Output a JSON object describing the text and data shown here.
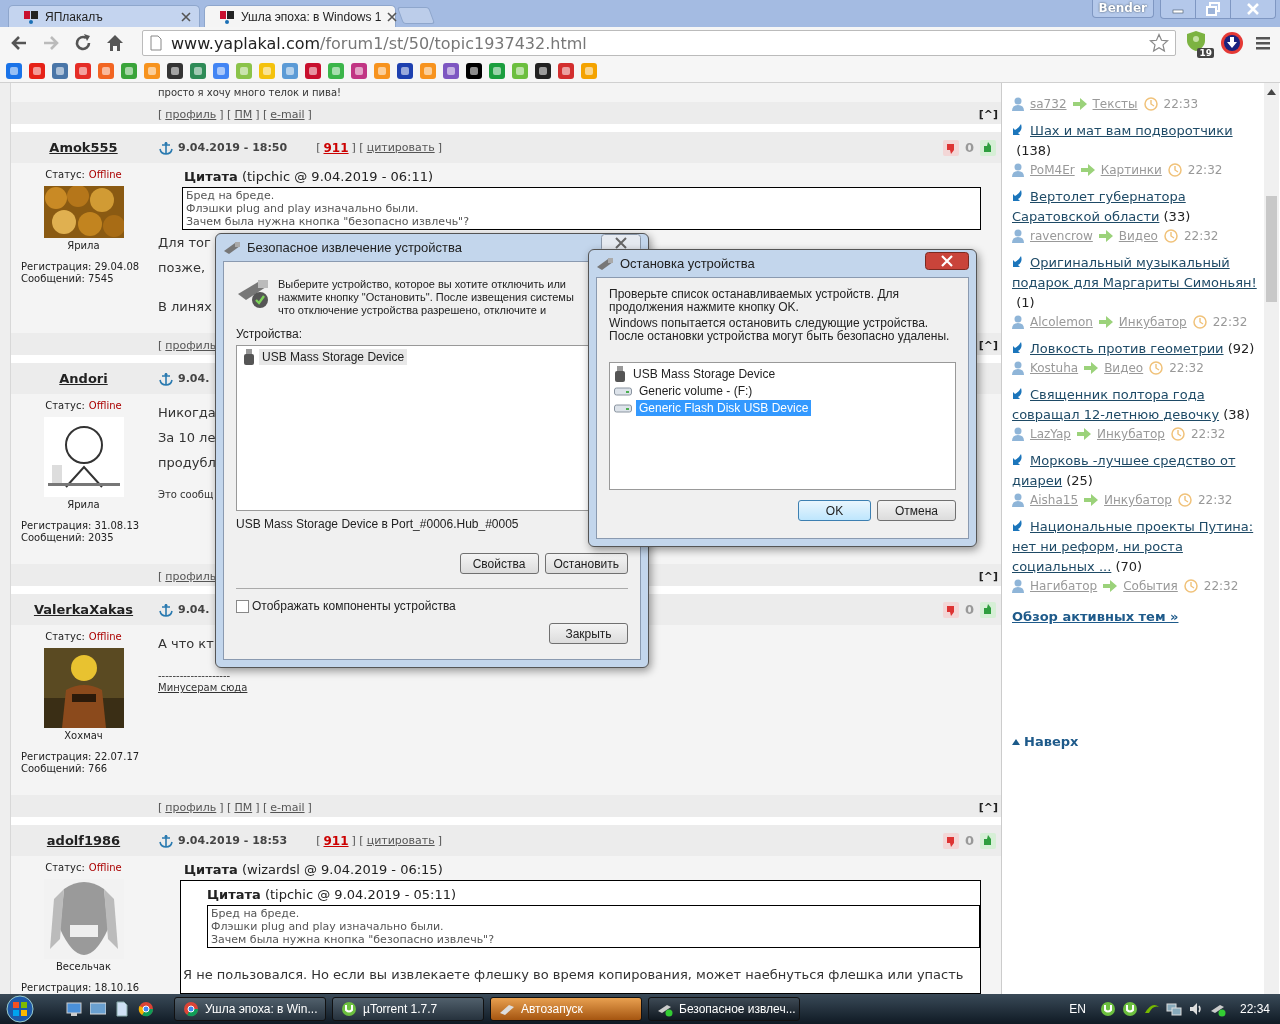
{
  "browser": {
    "tabs": [
      {
        "title": "ЯПлакалъ",
        "selected": false
      },
      {
        "title": "Ушла эпоха: в Windows 1",
        "selected": true
      }
    ],
    "profile": "Bender",
    "url_host": "www.yaplakal.com",
    "url_path": "/forum1/st/50/topic1937432.html",
    "extension_badge": "19",
    "bookmarks": [
      {
        "color": "#1a73e8"
      },
      {
        "color": "#e62117"
      },
      {
        "color": "#4a76a8"
      },
      {
        "color": "#e52d27"
      },
      {
        "color": "#f26522"
      },
      {
        "color": "#3aa43a"
      },
      {
        "color": "#f7931e"
      },
      {
        "color": "#333333"
      },
      {
        "color": "#2e8b57"
      },
      {
        "color": "#4285f4"
      },
      {
        "color": "#8bc34a"
      },
      {
        "color": "#f4c20d"
      },
      {
        "color": "#5c9bd6"
      },
      {
        "color": "#c8102e"
      },
      {
        "color": "#3bb54a"
      },
      {
        "color": "#c13584"
      },
      {
        "color": "#f7931e"
      },
      {
        "color": "#1e40af"
      },
      {
        "color": "#f7931e"
      },
      {
        "color": "#7e57c2"
      },
      {
        "color": "#000000"
      },
      {
        "color": "#1b9e3e"
      },
      {
        "color": "#6cbf3f"
      },
      {
        "color": "#222222"
      },
      {
        "color": "#d32f2f"
      },
      {
        "color": "#f4a300"
      }
    ]
  },
  "forum": {
    "top_text": "просто я хочу много телок и пива!",
    "top_footer": [
      {
        "kind": "text",
        "text": "["
      },
      {
        "kind": "link",
        "text": "профиль"
      },
      {
        "kind": "text",
        "text": "] ["
      },
      {
        "kind": "link",
        "text": "ПМ"
      },
      {
        "kind": "text",
        "text": "] ["
      },
      {
        "kind": "link",
        "text": "e-mail"
      },
      {
        "kind": "text",
        "text": "]"
      }
    ],
    "top_up": "[^]",
    "posts": [
      {
        "author": "Amok555",
        "status_label": "Статус:",
        "status": "Offline",
        "avatar": {
          "kind": "picture"
        },
        "rank": "Ярила",
        "registered": "Регистрация: 29.04.08",
        "messages": "Сообщений: 7545",
        "date": "9.04.2019 - 18:50",
        "head_links": [
          {
            "kind": "text",
            "text": "["
          },
          {
            "kind": "rating",
            "text": "911"
          },
          {
            "kind": "text",
            "text": "] ["
          },
          {
            "kind": "link",
            "text": "цитировать"
          },
          {
            "kind": "text",
            "text": "]"
          }
        ],
        "votes": "0",
        "body": [
          {
            "kind": "quote",
            "title": "**Цитата** (tipchic @ 9.04.2019 - 06:11)",
            "lines": [
              "Бред на бреде.",
              "Флэшки plug and play изначально были.",
              "Зачем была нужна кнопка \"безопасно извлечь\"?"
            ]
          },
          {
            "kind": "text",
            "text": "Для тог"
          },
          {
            "kind": "text",
            "text": "позже,"
          },
          {
            "kind": "gap"
          },
          {
            "kind": "text",
            "text": "В линях"
          }
        ],
        "footer": [
          {
            "kind": "text",
            "text": "["
          },
          {
            "kind": "link",
            "text": "профиль"
          }
        ],
        "up": "[^]"
      },
      {
        "author": "Andori",
        "status_label": "Статус:",
        "status": "Offline",
        "avatar": {
          "kind": "picture"
        },
        "rank": "Ярила",
        "registered": "Регистрация: 31.08.13",
        "messages": "Сообщений: 2035",
        "date": "9.04.",
        "body": [
          {
            "kind": "text",
            "text": "Никогда"
          },
          {
            "kind": "text",
            "text": "За 10 ле"
          },
          {
            "kind": "text",
            "text": "продубл"
          },
          {
            "kind": "gap"
          },
          {
            "kind": "note",
            "text": "Это сообщ"
          }
        ],
        "footer": [
          {
            "kind": "text",
            "text": "["
          },
          {
            "kind": "link",
            "text": "профиль"
          }
        ],
        "up": "[^]"
      },
      {
        "author": "ValerkaXakas",
        "status_label": "Статус:",
        "status": "Offline",
        "avatar": {
          "kind": "picture"
        },
        "rank": "Хохмач",
        "registered": "Регистрация: 22.07.17",
        "messages": "Сообщений: 766",
        "date": "9.04.",
        "votes": "0",
        "body": [
          {
            "kind": "text",
            "text": "А что кт"
          },
          {
            "kind": "gap"
          },
          {
            "kind": "note",
            "text": "--------------------"
          },
          {
            "kind": "notelink",
            "text": "Минусерам сюда"
          }
        ],
        "footer": [
          {
            "kind": "text",
            "text": "["
          },
          {
            "kind": "link",
            "text": "профиль"
          },
          {
            "kind": "text",
            "text": "] ["
          },
          {
            "kind": "link",
            "text": "ПМ"
          },
          {
            "kind": "text",
            "text": "] ["
          },
          {
            "kind": "link",
            "text": "e-mail"
          },
          {
            "kind": "text",
            "text": "]"
          }
        ],
        "up": "[^]"
      },
      {
        "author": "adolf1986",
        "status_label": "Статус:",
        "status": "Offline",
        "avatar": {
          "kind": "picture"
        },
        "rank": "Весельчак",
        "registered": "Регистрация: 18.10.16",
        "date": "9.04.2019 - 18:53",
        "head_links": [
          {
            "kind": "text",
            "text": "["
          },
          {
            "kind": "rating",
            "text": "911"
          },
          {
            "kind": "text",
            "text": "] ["
          },
          {
            "kind": "link",
            "text": "цитировать"
          },
          {
            "kind": "text",
            "text": "]"
          }
        ],
        "votes": "0",
        "body": [
          {
            "kind": "outer",
            "title": "**Цитата** (wizardsl @ 9.04.2019 - 06:15)",
            "blocks": [
              {
                "kind": "quote",
                "title": "**Цитата** (tipchic @ 9.04.2019 - 05:11)",
                "lines": [
                  "Бред на бреде.",
                  "Флэшки plug and play изначально были.",
                  "Зачем была нужна кнопка \"безопасно извлечь\"?"
                ]
              },
              {
                "kind": "text",
                "text": "Я не пользовался. Но если вы извлекаете флешку во время копирования, может наебнуться флешка или упасть"
              }
            ]
          }
        ]
      }
    ]
  },
  "sidebar": {
    "items": [
      {
        "user": "sa732",
        "section": "Тексты",
        "time": "22:33"
      },
      {
        "title": "Шах и мат вам подворотчики",
        "count": "(138)",
        "user": "PoM4Er",
        "section": "Картинки",
        "time": "22:32"
      },
      {
        "title": "Вертолет губернатора Саратовской области",
        "count": "(33)",
        "user": "ravencrow",
        "section": "Видео",
        "time": "22:32"
      },
      {
        "title": "Оригинальный музыкальный подарок для Маргариты Симоньян!",
        "count": "(1)",
        "user": "Alcolemon",
        "section": "Инкубатор",
        "time": "22:32"
      },
      {
        "title": "Ловкость против геометрии",
        "count": "(92)",
        "user": "Kostuha",
        "section": "Видео",
        "time": "22:32"
      },
      {
        "title": "Священник полтора года совращал 12-летнюю девочку",
        "count": "(38)",
        "user": "LazYap",
        "section": "Инкубатор",
        "time": "22:32"
      },
      {
        "title": "Морковь -лучшее средство от диареи",
        "count": "(25)",
        "user": "Aisha15",
        "section": "Инкубатор",
        "time": "22:32"
      },
      {
        "title": "Национальные проекты Путина: нет ни реформ, ни роста социальных ...",
        "count": "(70)",
        "user": "Нагибатор",
        "section": "События",
        "time": "22:32"
      }
    ],
    "overview": "Обзор активных тем »",
    "up": "Наверх"
  },
  "dialog_remove": {
    "title": "Безопасное извлечение устройства",
    "intro": [
      "Выберите устройство, которое вы хотите отключить или",
      "нажмите кнопку \"Остановить\". После извещения системы",
      "что отключение устройства разрешено, отключите и"
    ],
    "devices_label": "Устройства:",
    "devices": [
      {
        "name": "USB Mass Storage Device",
        "selected": true
      }
    ],
    "location": "USB Mass Storage Device в Port_#0006.Hub_#0005",
    "buttons": [
      "Свойства",
      "Остановить"
    ],
    "show_components": {
      "label": "Отображать компоненты устройства",
      "checked": false
    },
    "close": "Закрыть"
  },
  "dialog_stop": {
    "title": "Остановка устройства",
    "text1": "Проверьте список останавливаемых устройств. Для продолжения нажмите кнопку OK.",
    "text2": "Windows попытается остановить следующие устройства. После остановки устройства могут быть безопасно удалены.",
    "devices": [
      {
        "name": "USB Mass Storage Device",
        "kind": "usb",
        "selected": false
      },
      {
        "name": "Generic volume - (F:)",
        "kind": "drive",
        "selected": false
      },
      {
        "name": "Generic Flash Disk USB Device",
        "kind": "drive",
        "selected": true
      }
    ],
    "ok": "OK",
    "cancel": "Отмена"
  },
  "taskbar": {
    "tasks": [
      {
        "label": "Ушла эпоха: в Win...",
        "kind": "browser",
        "flashing": false,
        "selected": false
      },
      {
        "label": "µTorrent 1.7.7",
        "kind": "torrent",
        "flashing": false,
        "selected": false
      },
      {
        "label": "Автозапуск",
        "kind": "autoplay",
        "flashing": true,
        "selected": false
      },
      {
        "label": "Безопасное извлеч...",
        "kind": "usb",
        "flashing": false,
        "selected": true
      }
    ],
    "language": "EN",
    "clock": "22:34"
  }
}
